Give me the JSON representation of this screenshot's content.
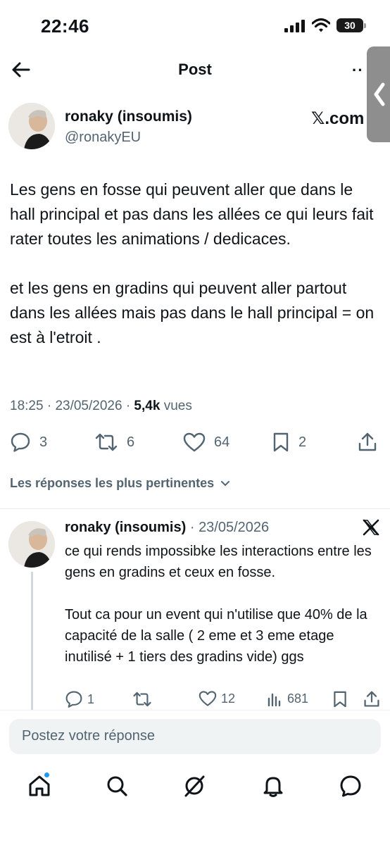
{
  "status_bar": {
    "time": "22:46",
    "battery": "30"
  },
  "header": {
    "title": "Post",
    "more_label": "··"
  },
  "post": {
    "author_name": "ronaky (insoumis)",
    "author_handle": "@ronakyEU",
    "source_label": "𝕏.com",
    "text": "Les gens en fosse qui peuvent aller que dans le hall principal et pas dans les allées ce qui leurs fait rater toutes les animations / dedicaces.\n\net les gens en gradins qui peuvent aller partout dans les allées mais pas dans le hall principal = on est à l'etroit .",
    "time": "18:25",
    "date": "23/05/2026",
    "views_count": "5,4k",
    "views_label": "vues",
    "separator": "·",
    "replies": "3",
    "reposts": "6",
    "likes": "64",
    "bookmarks": "2"
  },
  "replies_section": {
    "label": "Les réponses les plus pertinentes"
  },
  "reply": {
    "author_name": "ronaky (insoumis)",
    "date": "23/05/2026",
    "separator": "·",
    "text": "ce qui rends impossibke les interactions entre les gens en gradins et ceux en fosse.\n\nTout ca pour un event qui n'utilise que 40% de la capacité de la salle ( 2 eme et 3 eme etage inutilisé + 1 tiers des gradins vide) ggs",
    "replies": "1",
    "likes": "12",
    "views": "681"
  },
  "composer": {
    "placeholder": "Postez votre réponse"
  },
  "tabbar": {
    "items": [
      "home-icon",
      "search-icon",
      "grok-icon",
      "notifications-icon",
      "messages-icon"
    ]
  },
  "colors": {
    "accent": "#1d9bf0",
    "text": "#0f1419",
    "secondary": "#536471"
  }
}
